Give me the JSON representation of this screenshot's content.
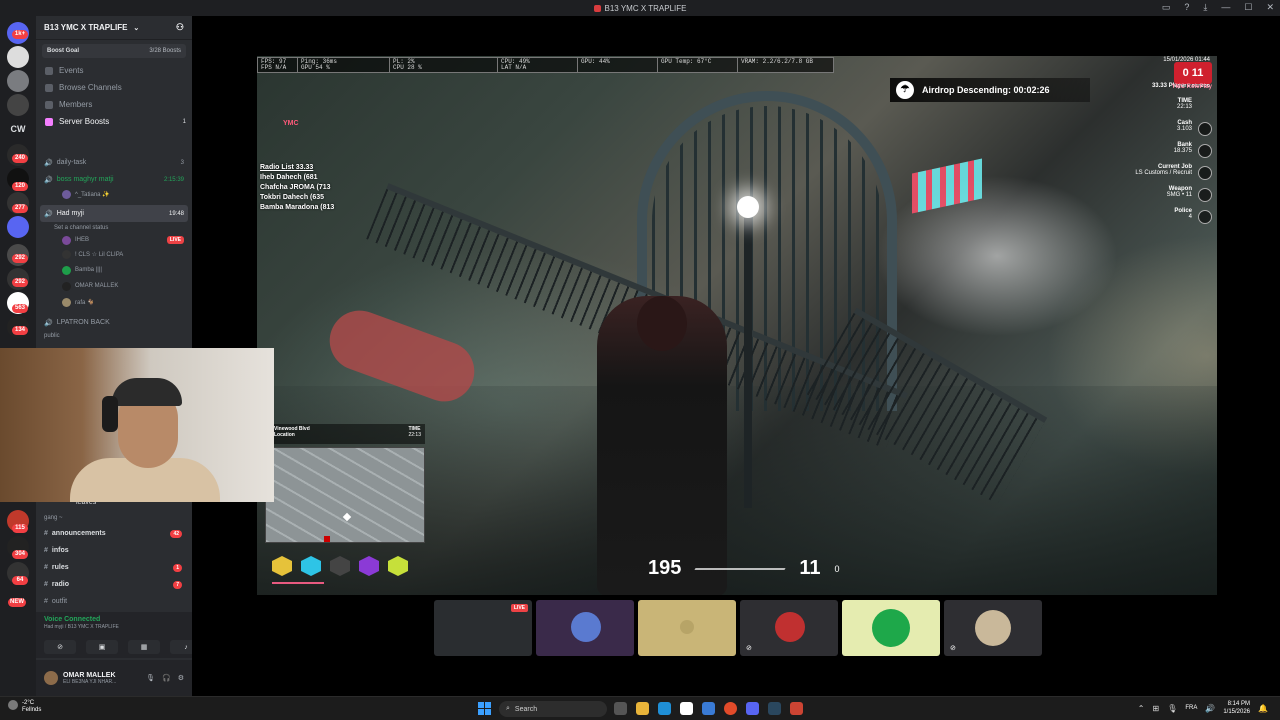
{
  "window": {
    "title": "B13 YMC X TRAPLIFE",
    "controls": [
      "▭",
      "?",
      "⤓",
      "—",
      "☐",
      "✕"
    ]
  },
  "rail": {
    "badges": [
      "1k+",
      "240",
      "120",
      "277",
      "292",
      "292",
      "563",
      "134"
    ],
    "label_cw": "CW",
    "lower_badges": [
      "115",
      "304",
      "64",
      "NEW"
    ]
  },
  "server": {
    "name": "B13 YMC X TRAPLIFE",
    "boost_goal_label": "Boost Goal",
    "boost_count": "3/28 Boosts",
    "nav": [
      {
        "label": "Events",
        "count": ""
      },
      {
        "label": "Browse Channels",
        "count": ""
      },
      {
        "label": "Members",
        "count": ""
      },
      {
        "label": "Server Boosts",
        "count": "1"
      }
    ]
  },
  "voice_channels": {
    "daily_task": {
      "label": "daily-task",
      "count": "3"
    },
    "boss": {
      "label": "boss maghyr matji",
      "time": "2:15:39",
      "member": "^_Tatiana ✨"
    },
    "had": {
      "label": "Had myji",
      "time": "19:48",
      "status": "Set a channel status"
    },
    "members": [
      {
        "name": "IHEB",
        "live": "LIVE"
      },
      {
        "name": "! CLS ☆ Lil CLIPA",
        "live": ""
      },
      {
        "name": "Bamba ||||",
        "live": ""
      },
      {
        "name": "OMAR MALLEK",
        "live": ""
      },
      {
        "name": "rafa 🐐",
        "live": ""
      }
    ],
    "lpatron": "LPATRON BACK",
    "public": "public"
  },
  "lower_channels": {
    "leaves_label": "leaves",
    "category": "gang ~",
    "items": [
      {
        "label": "announcements",
        "badge": "42"
      },
      {
        "label": "infos",
        "badge": ""
      },
      {
        "label": "rules",
        "badge": "1"
      },
      {
        "label": "radio",
        "badge": "7"
      },
      {
        "label": "outfit",
        "badge": ""
      }
    ]
  },
  "voice_status": {
    "title": "Voice Connected",
    "subtitle": "Had myji / B13 YMC X TRAPLIFE"
  },
  "user": {
    "name": "OMAR MALLEK",
    "status": "ELI BE3NA YJI NHAR..."
  },
  "hud": {
    "perf": [
      [
        "FPS: 97",
        "FPS N/A"
      ],
      [
        "Ping: 36ms",
        "GPU 54 %"
      ],
      [
        "PL: 2%",
        "CPU 28 %"
      ],
      [
        "CPU: 49%",
        "LAT N/A"
      ],
      [
        "GPU: 44%",
        ""
      ],
      [
        "GPU Temp: 67°C",
        ""
      ],
      [
        "VRAM: 2.2/6.2/7.8 GB",
        ""
      ]
    ],
    "airdrop": "Airdrop Descending: 00:02:26",
    "date": "15/01/2026 01:44",
    "players": "33.33  Players 61/256",
    "badge_number": "0 11",
    "ymc_label": "YMC RolePlay",
    "stats": [
      {
        "label": "TIME",
        "value": "22:13"
      },
      {
        "label": "Cash",
        "value": "3.103"
      },
      {
        "label": "Bank",
        "value": "18.375"
      },
      {
        "label": "Current Job",
        "value": "LS Customs / Recruit"
      },
      {
        "label": "Weapon",
        "value": "SMG • 11"
      },
      {
        "label": "Police",
        "value": "4"
      }
    ],
    "ymc_logo": "YMC",
    "radio": {
      "title": "Radio List 33.33",
      "entries": [
        "Iheb Dahech (681",
        "Chafcha JROMA (713",
        "Tokbri Dahech (635",
        "Bamba Maradona (813"
      ]
    },
    "location": {
      "street": "Vinewood Blvd",
      "label": "Location",
      "time_label": "TIME",
      "time": "22:13"
    },
    "ammo": {
      "clip": "195",
      "reserve": "11",
      "extra": "0"
    }
  },
  "taskbar": {
    "temp": "-2°C",
    "condition": "Fellnds",
    "search_placeholder": "Search",
    "lang": "FRA",
    "time": "8:14 PM",
    "date": "1/15/2026"
  },
  "colors": {
    "discord_bg": "#2b2d31",
    "discord_rail": "#1e1f22",
    "live_red": "#ed4245",
    "voice_green": "#23a55a"
  }
}
